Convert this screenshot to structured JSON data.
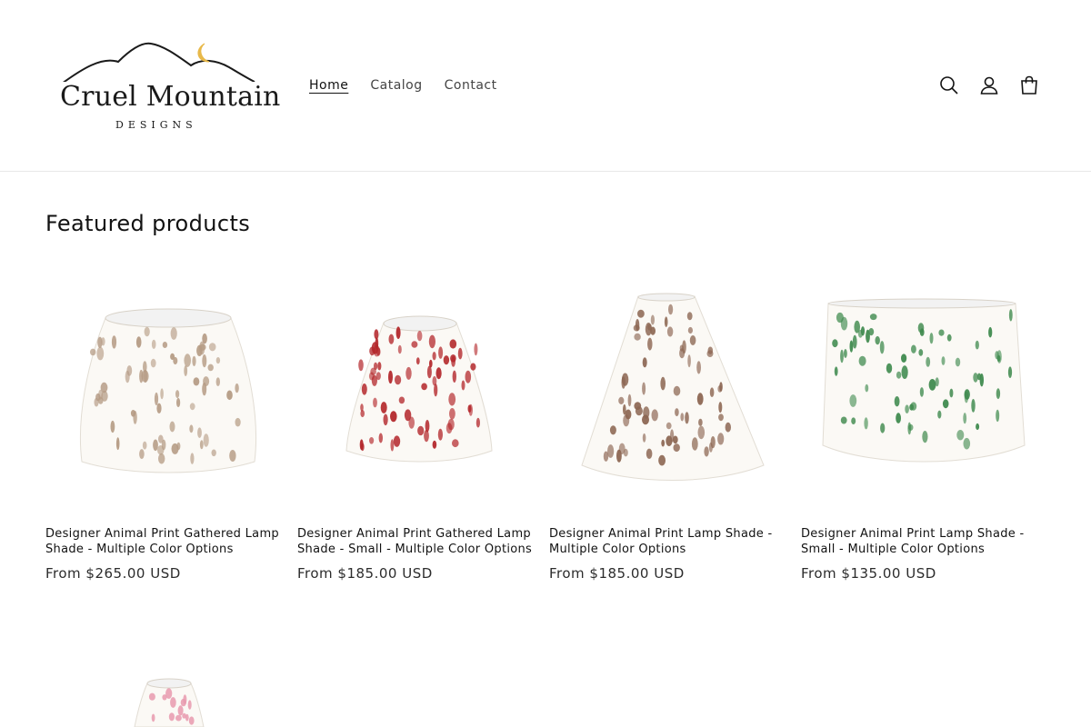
{
  "logo": {
    "name": "Cruel Mountain",
    "subtitle": "DESIGNS"
  },
  "nav": {
    "items": [
      "Home",
      "Catalog",
      "Contact"
    ],
    "active": "Home"
  },
  "header_icons": [
    "search-icon",
    "account-icon",
    "cart-icon"
  ],
  "section": {
    "title": "Featured products"
  },
  "products": [
    {
      "title": "Designer Animal Print Gathered Lamp Shade - Multiple Color Options",
      "price": "From $265.00 USD",
      "color": "#b59b84"
    },
    {
      "title": "Designer Animal Print Gathered Lamp Shade - Small - Multiple Color Options",
      "price": "From $185.00 USD",
      "color": "#b3262a"
    },
    {
      "title": "Designer Animal Print Lamp Shade - Multiple Color Options",
      "price": "From $185.00 USD",
      "color": "#8c6652"
    },
    {
      "title": "Designer Animal Print Lamp Shade - Small - Multiple Color Options",
      "price": "From $135.00 USD",
      "color": "#3f8a4e"
    }
  ],
  "partial_product": {
    "color": "#e79aae"
  },
  "colors": {
    "text": "#121212",
    "moon": "#e8b94a",
    "divider": "#e8e8e8"
  }
}
